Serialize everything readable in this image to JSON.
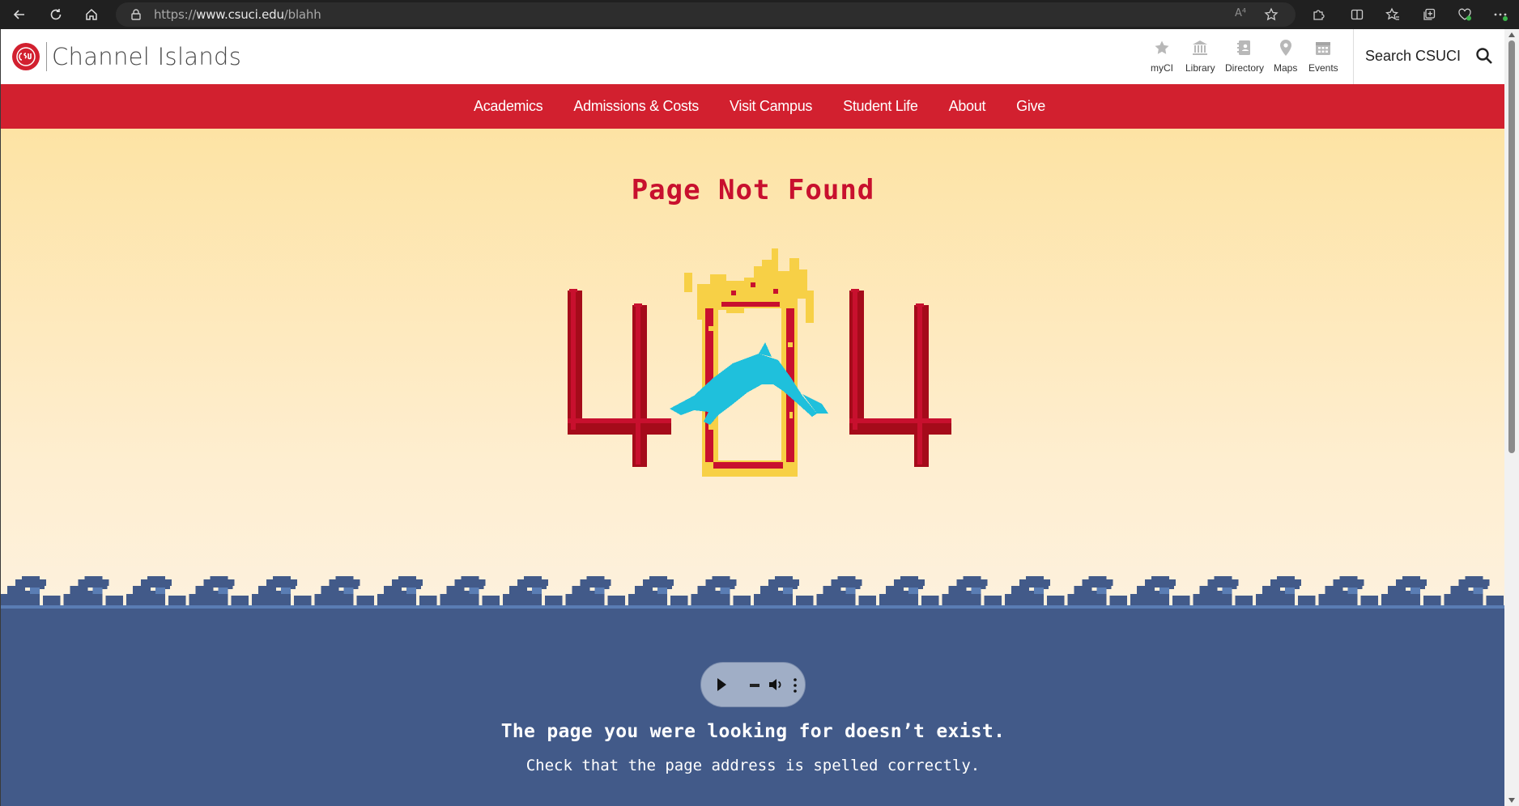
{
  "browser": {
    "url_scheme": "https://",
    "url_host": "www.csuci.edu",
    "url_path": "/blahh",
    "read_aloud_label": "A⁴"
  },
  "header": {
    "site_name": "Channel Islands",
    "logo_alt": "CSU",
    "utility_links": [
      {
        "label": "myCI",
        "icon": "star-icon"
      },
      {
        "label": "Library",
        "icon": "library-icon"
      },
      {
        "label": "Directory",
        "icon": "directory-icon"
      },
      {
        "label": "Maps",
        "icon": "map-pin-icon"
      },
      {
        "label": "Events",
        "icon": "calendar-icon"
      }
    ],
    "search_label": "Search CSUCI"
  },
  "nav": {
    "items": [
      "Academics",
      "Admissions & Costs",
      "Visit Campus",
      "Student Life",
      "About",
      "Give"
    ]
  },
  "main": {
    "title": "Page Not Found",
    "error_code": "404",
    "message": "The page you were looking for doesn’t exist.",
    "hint": "Check that the page address is spelled correctly."
  },
  "colors": {
    "brand_red": "#d2202f",
    "ocean_blue": "#425a89",
    "flame_yellow": "#f7d046",
    "dolphin_cyan": "#1fc0dc"
  }
}
